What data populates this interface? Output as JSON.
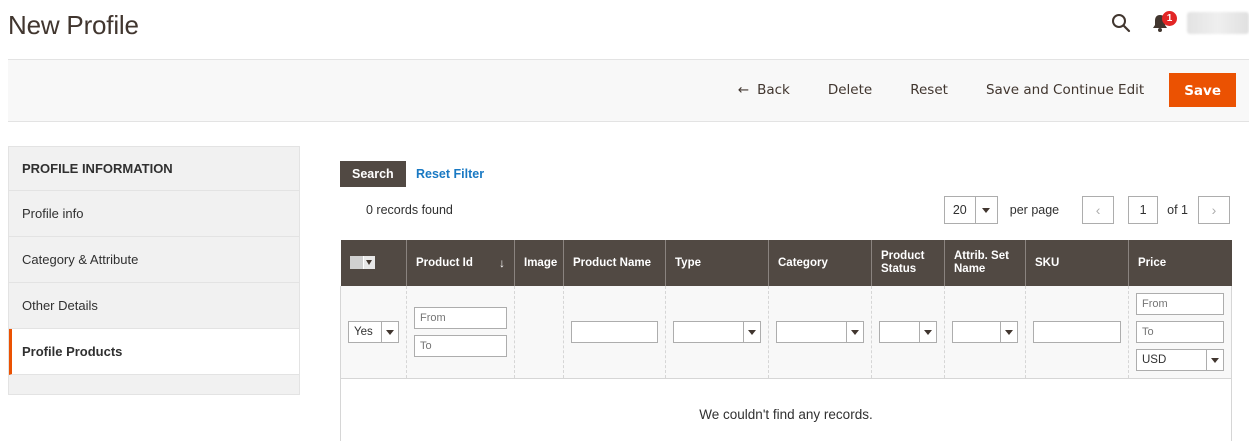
{
  "header": {
    "title": "New Profile",
    "notifications_count": "1"
  },
  "actions": {
    "back_label": "Back",
    "delete_label": "Delete",
    "reset_label": "Reset",
    "save_continue_label": "Save and Continue Edit",
    "save_label": "Save"
  },
  "sidebar": {
    "heading": "PROFILE INFORMATION",
    "items": [
      {
        "label": "Profile info"
      },
      {
        "label": "Category & Attribute"
      },
      {
        "label": "Other Details"
      },
      {
        "label": "Profile Products"
      }
    ],
    "active_index": 3
  },
  "grid_toolbar": {
    "search_label": "Search",
    "reset_filter_label": "Reset Filter",
    "records_text": "0 records found",
    "per_page_value": "20",
    "per_page_label": "per page",
    "page_number": "1",
    "page_of": "of 1"
  },
  "table": {
    "columns": [
      "",
      "Product Id",
      "Image",
      "Product Name",
      "Type",
      "Category",
      "Product Status",
      "Attrib. Set Name",
      "SKU",
      "Price"
    ],
    "filters": {
      "mass_select_value": "Yes",
      "id_from_placeholder": "From",
      "id_to_placeholder": "To",
      "price_from_placeholder": "From",
      "price_to_placeholder": "To",
      "currency_value": "USD"
    },
    "empty_message": "We couldn't find any records."
  },
  "colors": {
    "accent": "#eb5202",
    "header_bg": "#514943",
    "link": "#1979c3",
    "badge": "#e22626"
  }
}
